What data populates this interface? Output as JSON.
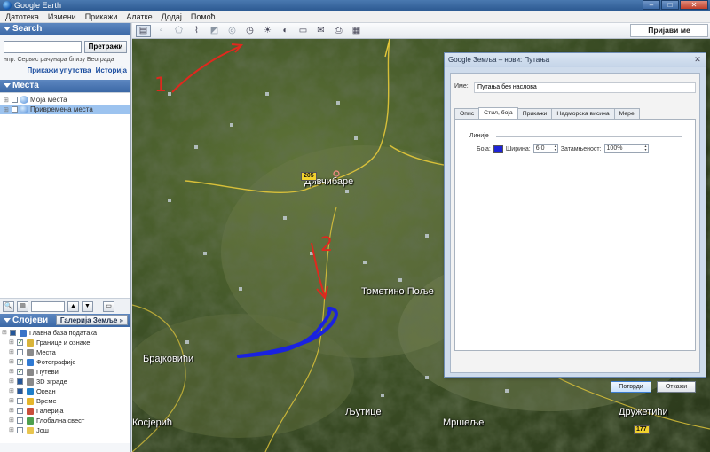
{
  "window": {
    "title": "Google Earth",
    "controls": [
      "–",
      "□",
      "✕"
    ]
  },
  "menu": [
    "Датотека",
    "Измени",
    "Прикажи",
    "Алатке",
    "Додај",
    "Помоћ"
  ],
  "search": {
    "header": "Search",
    "placeholder": "",
    "button": "Претражи",
    "hint": "нпр: Сервис рачунара близу Београда",
    "links": [
      "Прикажи упутства",
      "Историја"
    ]
  },
  "places": {
    "header": "Места",
    "items": [
      {
        "label": "Моја места",
        "selected": false
      },
      {
        "label": "Привремена места",
        "selected": true
      }
    ]
  },
  "places_toolbar": {
    "up": "▲",
    "down": "▼"
  },
  "layers": {
    "header": "Слојеви",
    "gallery_button": "Галерија Земље »",
    "items": [
      {
        "label": "Главна база података",
        "checked": "part",
        "color": "#3a74c8"
      },
      {
        "label": "Границе и ознаке",
        "checked": "on",
        "color": "#d9b43a"
      },
      {
        "label": "Места",
        "checked": "off",
        "color": "#8a8a8a"
      },
      {
        "label": "Фотографије",
        "checked": "on",
        "color": "#2f7ad3"
      },
      {
        "label": "Путеви",
        "checked": "on",
        "color": "#888888"
      },
      {
        "label": "3D зграде",
        "checked": "part",
        "color": "#8a8a8a"
      },
      {
        "label": "Океан",
        "checked": "part",
        "color": "#1f7fc9"
      },
      {
        "label": "Време",
        "checked": "off",
        "color": "#e5b62b"
      },
      {
        "label": "Галерија",
        "checked": "off",
        "color": "#c94e3b"
      },
      {
        "label": "Глобална свест",
        "checked": "off",
        "color": "#4ea04e"
      },
      {
        "label": "Још",
        "checked": "off",
        "color": "#e8c54f"
      }
    ]
  },
  "map_toolbar": {
    "icons": [
      "sidebar-icon",
      "placemark-icon",
      "polygon-icon",
      "path-icon",
      "overlay-icon",
      "tour-icon",
      "history-icon",
      "sun-icon",
      "planet-icon",
      "ruler-icon",
      "email-icon",
      "print-icon",
      "map-view-icon"
    ],
    "sign_in": "Пријави ме"
  },
  "map": {
    "towns": [
      "Дивчибаре",
      "Тометино Поље",
      "Брајковићи",
      "Косјерић",
      "Љутице",
      "Мршеље",
      "Дружетићи"
    ],
    "road_shields": [
      "205",
      "177"
    ],
    "annotations": [
      "1",
      "2",
      "3"
    ]
  },
  "dialog": {
    "title": "Google Земља – нови: Путања",
    "name_label": "Име:",
    "name_value": "Путања без наслова",
    "tabs": [
      "Опис",
      "Стил, боја",
      "Прикажи",
      "Надморска висина",
      "Мере"
    ],
    "active_tab": 1,
    "group_label": "Линије",
    "color_label": "Боја:",
    "line_color": "#1e24d8",
    "width_label": "Ширина:",
    "width_value": "6,0",
    "opacity_label": "Затамњеност:",
    "opacity_value": "100%",
    "ok": "Потврди",
    "cancel": "Откажи"
  }
}
